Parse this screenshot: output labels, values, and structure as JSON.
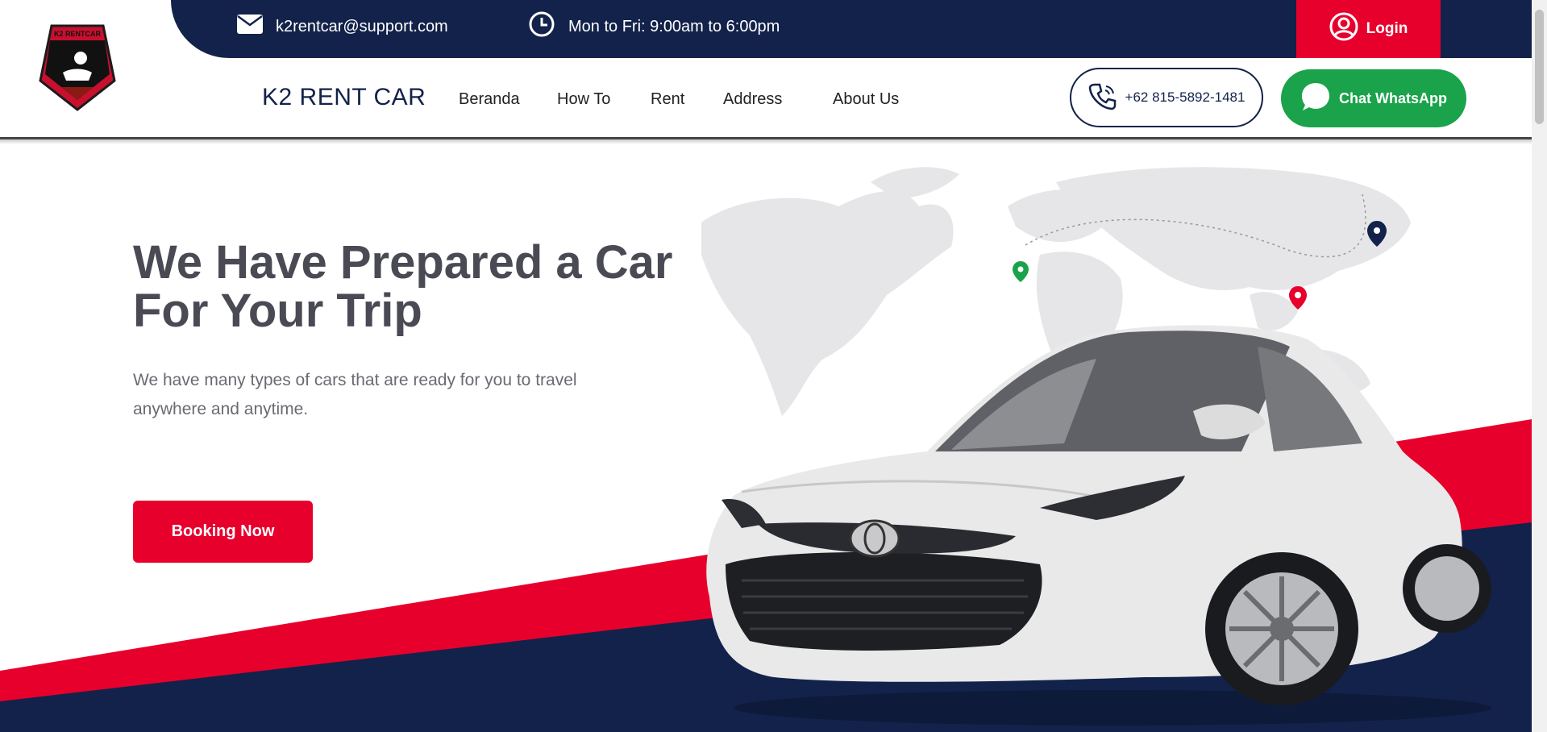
{
  "brand": {
    "logo_text": "K2 RENTCAR",
    "name": "K2 RENT CAR"
  },
  "topbar": {
    "email": "k2rentcar@support.com",
    "hours": "Mon to Fri: 9:00am to 6:00pm",
    "login_label": "Login"
  },
  "nav": {
    "items": [
      {
        "label": "Beranda"
      },
      {
        "label": "How To"
      },
      {
        "label": "Rent"
      },
      {
        "label": "Address"
      },
      {
        "label": "About Us"
      }
    ]
  },
  "contact": {
    "phone": "+62 815-5892-1481",
    "whatsapp_label": "Chat WhatsApp"
  },
  "hero": {
    "title_line1": "We Have Prepared a Car",
    "title_line2": "For Your Trip",
    "subtitle": "We have many types of cars that are ready for you to travel anywhere and anytime.",
    "cta_label": "Booking Now"
  },
  "colors": {
    "navy": "#13224a",
    "red": "#e8002d",
    "green": "#1aa34a"
  },
  "icons": {
    "email": "envelope-icon",
    "hours": "clock-icon",
    "login": "user-circle-icon",
    "phone": "phone-icon",
    "whatsapp": "chat-bubble-icon",
    "map_pins": [
      "green-pin-icon",
      "red-pin-icon",
      "navy-pin-icon"
    ]
  }
}
